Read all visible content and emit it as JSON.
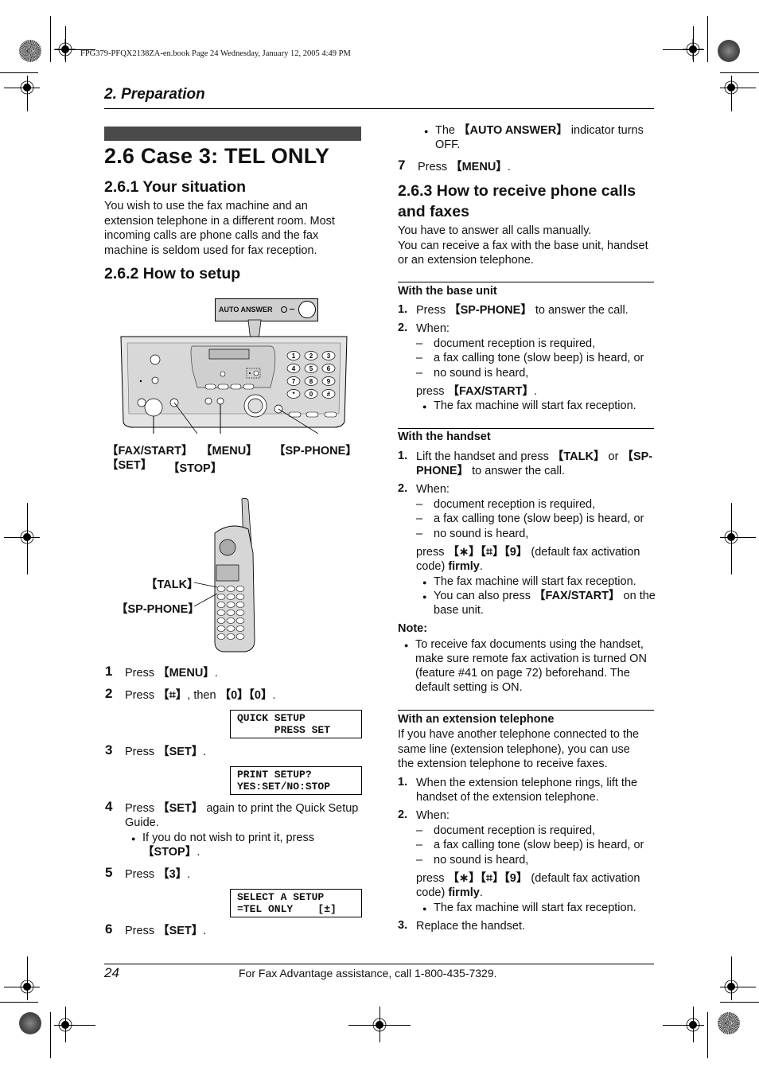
{
  "print_header": "FPG379-PFQX2138ZA-en.book  Page 24  Wednesday, January 12, 2005  4:49 PM",
  "chapter": "2. Preparation",
  "title": "2.6 Case 3: TEL ONLY",
  "s1": {
    "heading": "2.6.1 Your situation",
    "lines": [
      "You wish to use the fax machine and an",
      "extension telephone in a different room. Most",
      "incoming calls are phone calls and the fax",
      "machine is seldom used for fax reception."
    ]
  },
  "s2": {
    "heading": "2.6.2 How to setup",
    "diagram": {
      "auto_answer_label": "AUTO ANSWER",
      "keypad": [
        "1",
        "2",
        "3",
        "4",
        "5",
        "6",
        "7",
        "8",
        "9",
        "*",
        "0",
        "#"
      ],
      "callouts": {
        "fax_start": "【FAX/START】",
        "set": "【SET】",
        "stop": "【STOP】",
        "menu": "【MENU】",
        "sp_phone": "【SP-PHONE】",
        "talk": "【TALK】",
        "handset_sp_phone": "【SP-PHONE】"
      }
    },
    "steps": [
      {
        "n": "1",
        "pre": "Press ",
        "key": "【MENU】",
        "post": "."
      },
      {
        "n": "2",
        "pre": "Press ",
        "key": "【⌗】",
        "mid": ", then ",
        "key2": "【0】【0】",
        "post": "."
      },
      {
        "n": "3",
        "pre": "Press ",
        "key": "【SET】",
        "post": "."
      },
      {
        "n": "4",
        "pre": "Press ",
        "key": "【SET】",
        "post": " again to print the Quick Setup",
        "line2": "Guide.",
        "bullet_pre": "If you do not wish to print it, press",
        "bullet_key": "【STOP】",
        "bullet_post": "."
      },
      {
        "n": "5",
        "pre": "Press ",
        "key": "【3】",
        "post": "."
      },
      {
        "n": "6",
        "pre": "Press ",
        "key": "【SET】",
        "post": "."
      },
      {
        "n": "7",
        "pre": "Press ",
        "key": "【MENU】",
        "post": "."
      }
    ],
    "step6_bullet": {
      "pre": "The ",
      "key": "【AUTO ANSWER】",
      "post": " indicator turns",
      "line2": "OFF."
    },
    "displays": [
      {
        "line1": "QUICK SETUP",
        "line2": "      PRESS SET"
      },
      {
        "line1": "PRINT SETUP?",
        "line2": "YES:SET/NO:STOP"
      },
      {
        "line1": "SELECT A SETUP",
        "line2": "=TEL ONLY    [±]"
      }
    ]
  },
  "s3": {
    "heading_l1": "2.6.3 How to receive phone calls",
    "heading_l2": "and faxes",
    "intro": [
      "You have to answer all calls manually.",
      "You can receive a fax with the base unit, handset",
      "or an extension telephone."
    ],
    "base": {
      "title": "With the base unit",
      "i1": {
        "n": "1.",
        "pre": "Press ",
        "key": "【SP-PHONE】",
        "post": " to answer the call."
      },
      "i2": {
        "n": "2.",
        "text": "When:"
      },
      "dashes": [
        "document reception is required,",
        "a fax calling tone (slow beep) is heard, or",
        "no sound is heard,"
      ],
      "press_pre": "press ",
      "press_key": "【FAX/START】",
      "press_post": ".",
      "bullet": "The fax machine will start fax reception."
    },
    "handset": {
      "title": "With the handset",
      "i1": {
        "n": "1.",
        "pre": "Lift the handset and press ",
        "key": "【TALK】",
        "mid": " or ",
        "key2a": "【SP-",
        "key2b": "PHONE】",
        "post": " to answer the call."
      },
      "i2": {
        "n": "2.",
        "text": "When:"
      },
      "dashes": [
        "document reception is required,",
        "a fax calling tone (slow beep) is heard, or",
        "no sound is heard,"
      ],
      "press_pre": "press ",
      "press_key": "【∗】【⌗】【9】",
      "press_post": " (default fax activation",
      "line2_pre": "code) ",
      "line2_bold": "firmly",
      "line2_post": ".",
      "bullet1": "The fax machine will start fax reception.",
      "bullet2_pre": "You can also press ",
      "bullet2_key": "【FAX/START】",
      "bullet2_post": " on the",
      "bullet2_line2": "base unit."
    },
    "note": {
      "title": "Note:",
      "lines": [
        "To receive fax documents using the handset,",
        "make sure remote fax activation is turned ON",
        "(feature #41 on page 72) beforehand. The",
        "default setting is ON."
      ]
    },
    "extension": {
      "title": "With an extension telephone",
      "intro": [
        "If you have another telephone connected to the",
        "same line (extension telephone), you can use",
        "the extension telephone to receive faxes."
      ],
      "i1": {
        "n": "1.",
        "l1": "When the extension telephone rings, lift the",
        "l2": "handset of the extension telephone."
      },
      "i2": {
        "n": "2.",
        "text": "When:"
      },
      "dashes": [
        "document reception is required,",
        "a fax calling tone (slow beep) is heard, or",
        "no sound is heard,"
      ],
      "press_pre": "press ",
      "press_key": "【∗】【⌗】【9】",
      "press_post": " (default fax activation",
      "line2_pre": "code) ",
      "line2_bold": "firmly",
      "line2_post": ".",
      "bullet": "The fax machine will start fax reception.",
      "i3": {
        "n": "3.",
        "text": "Replace the handset."
      }
    }
  },
  "footer": {
    "page": "24",
    "text": "For Fax Advantage assistance, call 1-800-435-7329."
  }
}
